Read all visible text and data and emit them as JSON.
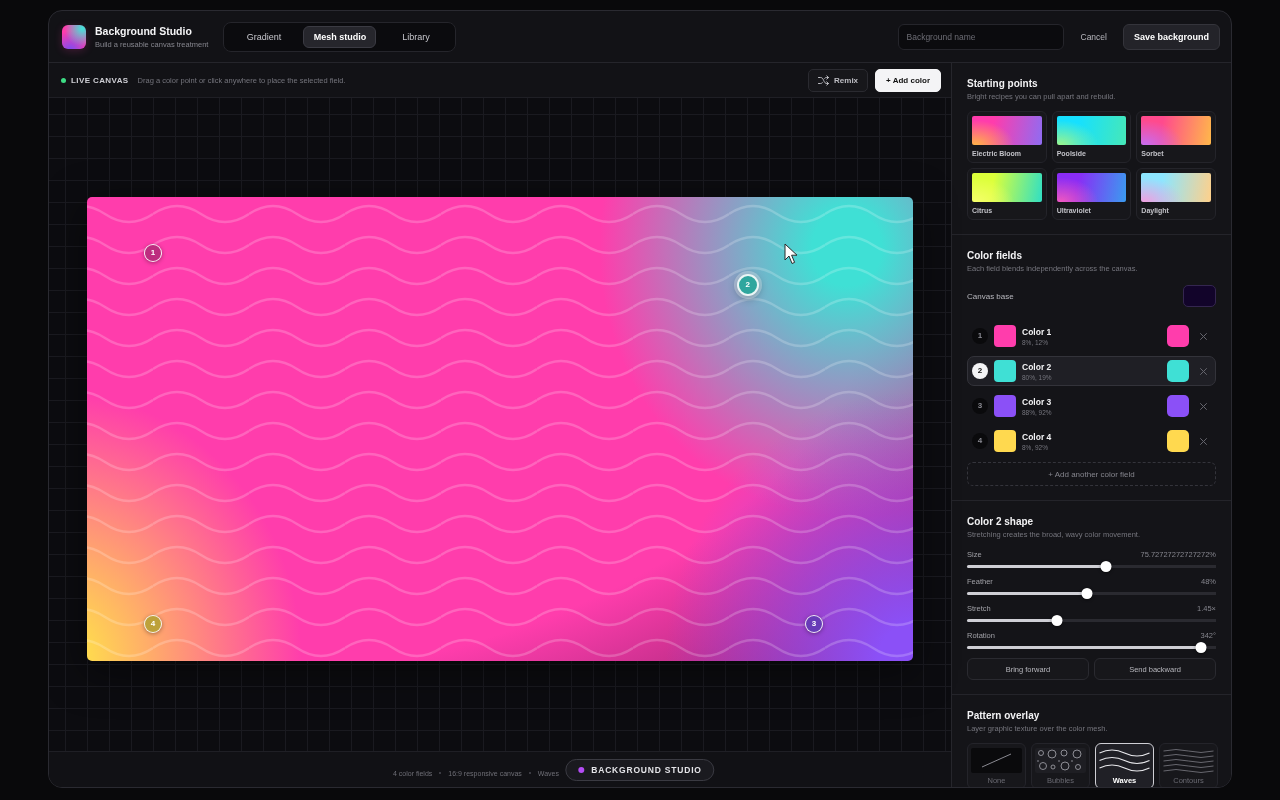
{
  "app": {
    "title": "Background Studio",
    "subtitle": "Build a reusable canvas treatment"
  },
  "tabs": [
    {
      "label": "Gradient",
      "selected": false
    },
    {
      "label": "Mesh studio",
      "selected": true
    },
    {
      "label": "Library",
      "selected": false
    }
  ],
  "header": {
    "name_field": {
      "placeholder": "Background name"
    },
    "cancel_button": "Cancel",
    "save_button": "Save background"
  },
  "toolbar": {
    "status": "LIVE CANVAS",
    "hint": "Drag a color point or click anywhere to place the selected field.",
    "buttons": [
      {
        "label": "Remix",
        "kind": "ghost"
      },
      {
        "label": "+ Add color",
        "kind": "primary"
      }
    ]
  },
  "canvas": {
    "markers": [
      {
        "label": "1",
        "selected": false
      },
      {
        "label": "2",
        "selected": true
      },
      {
        "label": "3",
        "selected": false
      },
      {
        "label": "4",
        "selected": false
      }
    ]
  },
  "status_bar": {
    "items": [
      "4 color fields",
      "16:9 responsive canvas",
      "Waves"
    ]
  },
  "floating_badge": {
    "label": "BACKGROUND STUDIO"
  },
  "starting_points": {
    "title": "Starting points",
    "subtitle": "Bright recipes you can pull apart and rebuild.",
    "presets": [
      {
        "label": "Electric Bloom"
      },
      {
        "label": "Poolside"
      },
      {
        "label": "Sorbet"
      },
      {
        "label": "Citrus"
      },
      {
        "label": "Ultraviolet"
      },
      {
        "label": "Daylight"
      }
    ]
  },
  "color_fields": {
    "title": "Color fields",
    "subtitle": "Each field blends independently across the canvas.",
    "canvas_base": {
      "label": "Canvas base",
      "color": "#12042a"
    },
    "fields": [
      {
        "number": "1",
        "name": "Color 1",
        "position": "8%, 12%",
        "color": "#ff3dac",
        "selected": false
      },
      {
        "number": "2",
        "name": "Color 2",
        "position": "80%, 19%",
        "color": "#3fe0d5",
        "selected": true
      },
      {
        "number": "3",
        "name": "Color 3",
        "position": "88%, 92%",
        "color": "#8b50f7",
        "selected": false
      },
      {
        "number": "4",
        "name": "Color 4",
        "position": "8%, 92%",
        "color": "#ffd94f",
        "selected": false
      }
    ],
    "add_button": "+ Add another color field"
  },
  "shape": {
    "title": "Color 2 shape",
    "subtitle": "Stretching creates the broad, wavy color movement.",
    "sliders": [
      {
        "label": "Size",
        "reading": "75.72727272727272%",
        "level": 0.56
      },
      {
        "label": "Feather",
        "reading": "48%",
        "level": 0.48
      },
      {
        "label": "Stretch",
        "reading": "1.45×",
        "level": 0.36
      },
      {
        "label": "Rotation",
        "reading": "342°",
        "level": 0.94
      }
    ],
    "buttons": [
      "Bring forward",
      "Send backward"
    ]
  },
  "pattern": {
    "title": "Pattern overlay",
    "subtitle": "Layer graphic texture over the color mesh.",
    "options": [
      {
        "label": "None",
        "kind": "none",
        "selected": false
      },
      {
        "label": "Bubbles",
        "kind": "bubbles",
        "selected": false
      },
      {
        "label": "Waves",
        "kind": "waves",
        "selected": true
      },
      {
        "label": "Contours",
        "kind": "contours",
        "selected": false
      }
    ]
  }
}
